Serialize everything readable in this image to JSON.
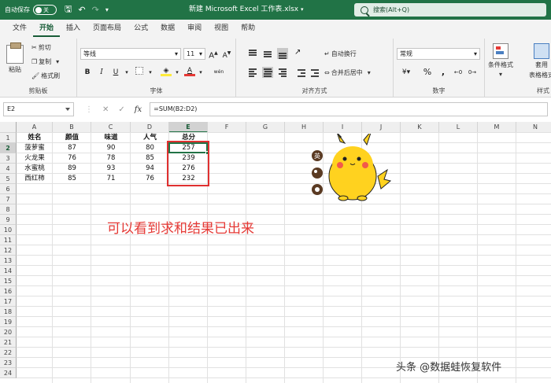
{
  "titlebar": {
    "autosave_label": "自动保存",
    "autosave_state": "关",
    "doc_title": "新建 Microsoft Excel 工作表.xlsx",
    "search_label": "搜索(Alt+Q)"
  },
  "menu": [
    "文件",
    "开始",
    "插入",
    "页面布局",
    "公式",
    "数据",
    "审阅",
    "视图",
    "帮助"
  ],
  "ribbon": {
    "clipboard": {
      "paste": "粘贴",
      "cut": "剪切",
      "copy": "复制",
      "painter": "格式刷",
      "label": "剪贴板"
    },
    "font": {
      "name": "等线",
      "size": "11",
      "bold": "B",
      "italic": "I",
      "underline": "U",
      "wen": "wén",
      "label": "字体"
    },
    "align": {
      "wrap": "自动换行",
      "merge": "合并后居中",
      "label": "对齐方式"
    },
    "number": {
      "format": "常规",
      "percent": "%",
      "comma": ",",
      "label": "数字"
    },
    "styles": {
      "cond": "条件格式",
      "table": "套用",
      "table2": "表格格式",
      "label": "样式"
    }
  },
  "formula_bar": {
    "name_box": "E2",
    "fx": "fx",
    "cancel": "✕",
    "enter": "✓",
    "formula": "=SUM(B2:D2)"
  },
  "columns": [
    "A",
    "B",
    "C",
    "D",
    "E",
    "F",
    "G",
    "H",
    "I",
    "J",
    "K",
    "L",
    "M",
    "N"
  ],
  "rows": [
    "1",
    "2",
    "3",
    "4",
    "5",
    "6",
    "7",
    "8",
    "9",
    "10",
    "11",
    "12",
    "13",
    "14",
    "15",
    "16",
    "17",
    "18",
    "19",
    "20",
    "21",
    "22",
    "23",
    "24"
  ],
  "table": {
    "headers": [
      "姓名",
      "颜值",
      "味道",
      "人气",
      "总分"
    ],
    "data": [
      [
        "菠萝蜜",
        "87",
        "90",
        "80",
        "257"
      ],
      [
        "火龙果",
        "76",
        "78",
        "85",
        "239"
      ],
      [
        "水蜜桃",
        "89",
        "93",
        "94",
        "276"
      ],
      [
        "西红柿",
        "85",
        "71",
        "76",
        "232"
      ]
    ]
  },
  "sticker": {
    "char": "英"
  },
  "annotation": "可以看到求和结果已出来",
  "watermark": "头条 @数据蛙恢复软件",
  "colors": {
    "excel_green": "#217346",
    "highlight_red": "#e03030",
    "annotation_red": "#e53935"
  }
}
